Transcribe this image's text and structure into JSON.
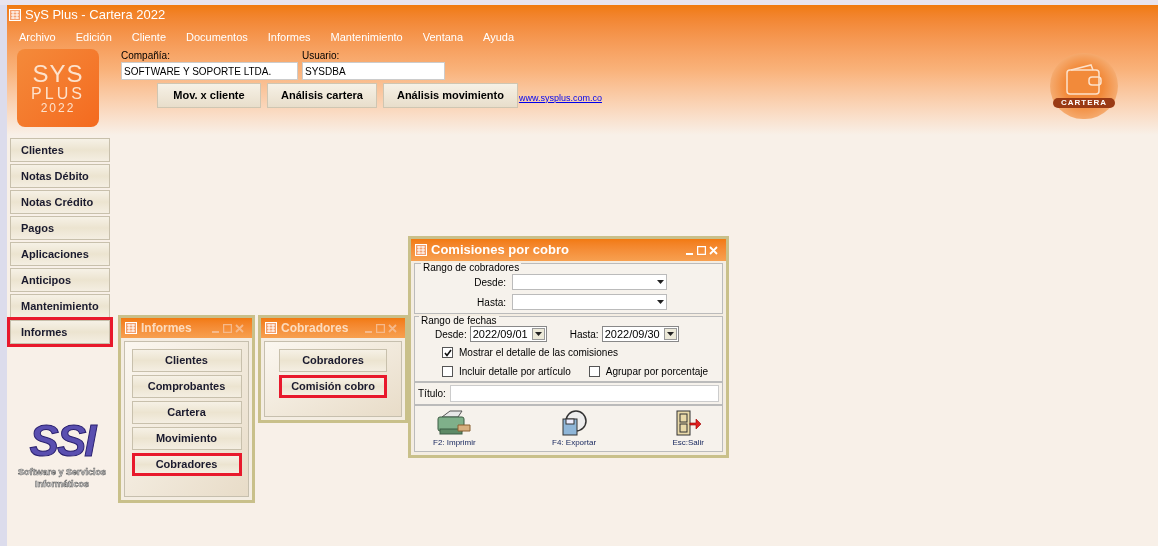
{
  "window": {
    "title": "SyS Plus - Cartera 2022"
  },
  "menu": [
    "Archivo",
    "Edición",
    "Cliente",
    "Documentos",
    "Informes",
    "Mantenimiento",
    "Ventana",
    "Ayuda"
  ],
  "logo": {
    "brand": "SYS",
    "sub": "PLUS",
    "year": "2022"
  },
  "company": {
    "label": "Compañía:",
    "value": "SOFTWARE Y SOPORTE LTDA."
  },
  "user": {
    "label": "Usuario:",
    "value": "SYSDBA"
  },
  "toolbar": [
    "Mov. x cliente",
    "Análisis cartera",
    "Análisis movimiento"
  ],
  "link": "www.sysplus.com.co",
  "module_badge": "CARTERA",
  "sidebar": [
    {
      "label": "Clientes",
      "highlighted": false
    },
    {
      "label": "Notas Débito",
      "highlighted": false
    },
    {
      "label": "Notas Crédito",
      "highlighted": false
    },
    {
      "label": "Pagos",
      "highlighted": false
    },
    {
      "label": "Aplicaciones",
      "highlighted": false
    },
    {
      "label": "Anticipos",
      "highlighted": false
    },
    {
      "label": "Mantenimiento",
      "highlighted": false
    },
    {
      "label": "Informes",
      "highlighted": true
    }
  ],
  "vendor_logo": {
    "mark": "SSI",
    "caption": "Software y Servicios Informáticos"
  },
  "child_windows": [
    {
      "title": "Informes",
      "active": false,
      "buttons": [
        {
          "label": "Clientes",
          "highlighted": false
        },
        {
          "label": "Comprobantes",
          "highlighted": false
        },
        {
          "label": "Cartera",
          "highlighted": false
        },
        {
          "label": "Movimiento",
          "highlighted": false
        },
        {
          "label": "Cobradores",
          "highlighted": true
        }
      ]
    },
    {
      "title": "Cobradores",
      "active": false,
      "buttons": [
        {
          "label": "Cobradores",
          "highlighted": false
        },
        {
          "label": "Comisión cobro",
          "highlighted": true
        }
      ]
    }
  ],
  "dialog": {
    "title": "Comisiones por cobro",
    "active": true,
    "collector_range": {
      "legend": "Rango de cobradores",
      "from_label": "Desde:",
      "to_label": "Hasta:"
    },
    "date_range": {
      "legend": "Rango de fechas",
      "from_label": "Desde:",
      "from_value": "2022/09/01",
      "to_label": "Hasta:",
      "to_value": "2022/09/30"
    },
    "options": [
      {
        "label": "Mostrar el detalle de las comisiones",
        "checked": true
      },
      {
        "label": "Incluir detalle por artículo",
        "checked": false
      },
      {
        "label": "Agrupar por porcentaje",
        "checked": false
      }
    ],
    "title_label": "Título:",
    "actions": [
      {
        "kind": "print",
        "label": "F2: Imprimir"
      },
      {
        "kind": "export",
        "label": "F4: Exportar"
      },
      {
        "kind": "exit",
        "label": "Esc:Salir"
      }
    ]
  }
}
